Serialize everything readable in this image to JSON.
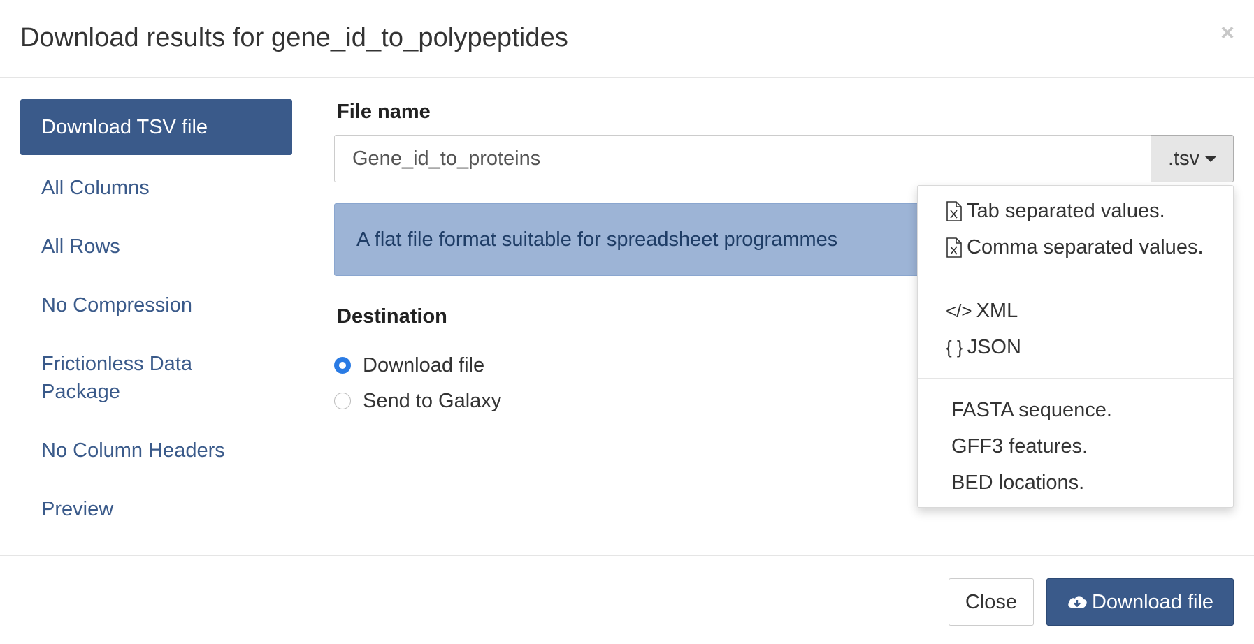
{
  "header": {
    "title": "Download results for gene_id_to_polypeptides",
    "close_glyph": "×"
  },
  "sidebar": {
    "items": [
      {
        "label": "Download TSV file",
        "active": true
      },
      {
        "label": "All Columns"
      },
      {
        "label": "All Rows"
      },
      {
        "label": "No Compression"
      },
      {
        "label": "Frictionless Data Package"
      },
      {
        "label": "No Column Headers"
      },
      {
        "label": "Preview"
      }
    ]
  },
  "main": {
    "file_name_label": "File name",
    "file_name_value": "Gene_id_to_proteins",
    "extension": ".tsv",
    "format_description": "A flat file format suitable for spreadsheet programmes",
    "destination_label": "Destination",
    "destinations": [
      {
        "label": "Download file",
        "checked": true
      },
      {
        "label": "Send to Galaxy",
        "checked": false
      }
    ]
  },
  "format_menu": {
    "items": [
      {
        "label": "Tab separated values.",
        "icon": "file-excel-icon"
      },
      {
        "label": "Comma separated values.",
        "icon": "file-excel-icon"
      },
      {
        "label": "XML",
        "icon": "code-icon",
        "glyph": "</>"
      },
      {
        "label": "JSON",
        "icon": "braces-icon",
        "glyph": "{ }"
      },
      {
        "label": "FASTA sequence."
      },
      {
        "label": "GFF3 features."
      },
      {
        "label": "BED locations."
      }
    ]
  },
  "footer": {
    "close_label": "Close",
    "download_label": "Download file"
  },
  "colors": {
    "primary": "#3a5a8a",
    "info_bg": "#9db4d6",
    "radio_accent": "#2a7be4"
  }
}
